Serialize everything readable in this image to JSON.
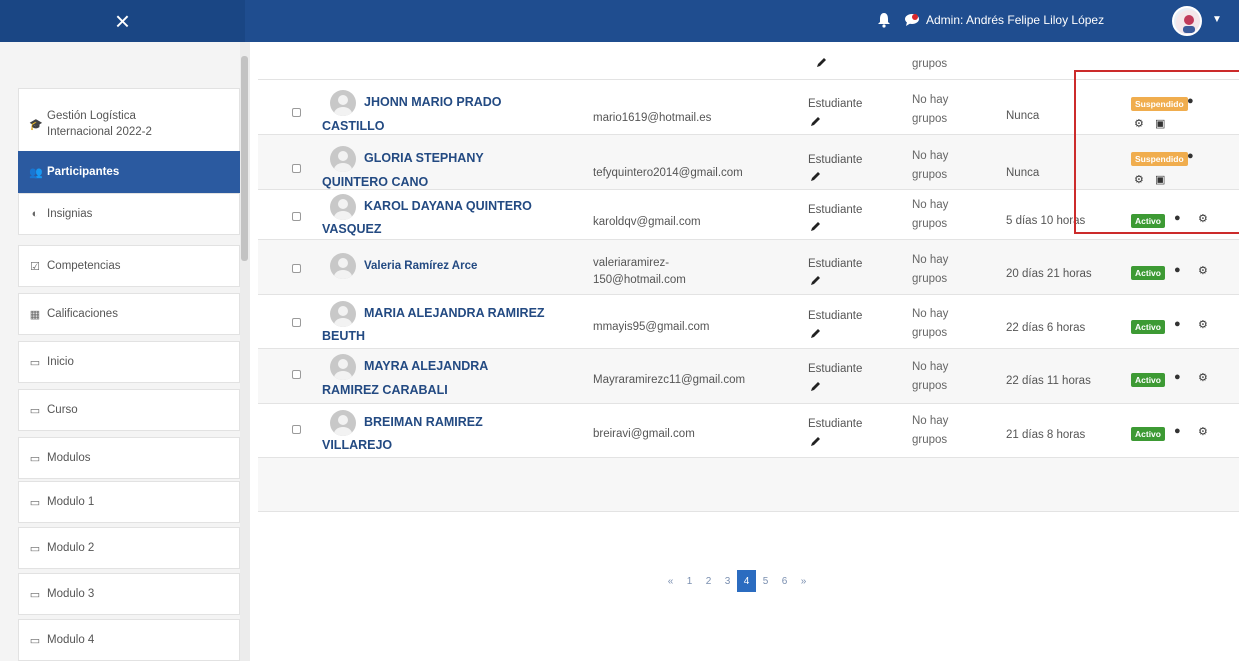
{
  "header": {
    "close_icon": "×",
    "admin_label": "Admin: Andrés Felipe Liloy López",
    "caret": "▼"
  },
  "sidebar": {
    "items": [
      {
        "label": "Gestión Logística Internacional 2022-2",
        "icon": "graduation-cap-icon",
        "glyph": "🎓"
      },
      {
        "label": "Participantes",
        "icon": "users-icon",
        "glyph": "👥",
        "active": true
      },
      {
        "label": "Insignias",
        "icon": "shield-icon",
        "glyph": "◐"
      },
      {
        "label": "Competencias",
        "icon": "checklist-icon",
        "glyph": "☑"
      },
      {
        "label": "Calificaciones",
        "icon": "table-icon",
        "glyph": "▦"
      },
      {
        "label": "Inicio",
        "icon": "folder-icon",
        "glyph": "▭"
      },
      {
        "label": "Curso",
        "icon": "folder-icon",
        "glyph": "▭"
      },
      {
        "label": "Modulos",
        "icon": "folder-icon",
        "glyph": "▭"
      },
      {
        "label": "Modulo 1",
        "icon": "folder-icon",
        "glyph": "▭"
      },
      {
        "label": "Modulo 2",
        "icon": "folder-icon",
        "glyph": "▭"
      },
      {
        "label": "Modulo 3",
        "icon": "folder-icon",
        "glyph": "▭"
      },
      {
        "label": "Modulo 4",
        "icon": "folder-icon",
        "glyph": "▭"
      }
    ]
  },
  "partial_row": {
    "groups": "grupos"
  },
  "participants": [
    {
      "name1": "JHONN MARIO PRADO",
      "name2": "CASTILLO",
      "email1": "mario1619@hotmail.es",
      "email2": "",
      "role": "Estudiante",
      "groups1": "No hay",
      "groups2": "grupos",
      "last_access": "Nunca",
      "status": "Suspendido"
    },
    {
      "name1": "GLORIA STEPHANY",
      "name2": "QUINTERO CANO",
      "email1": "tefyquintero2014@gmail.com",
      "email2": "",
      "role": "Estudiante",
      "groups1": "No hay",
      "groups2": "grupos",
      "last_access": "Nunca",
      "status": "Suspendido"
    },
    {
      "name1": "KAROL DAYANA QUINTERO",
      "name2": "VASQUEZ",
      "email1": "karoldqv@gmail.com",
      "email2": "",
      "role": "Estudiante",
      "groups1": "No hay",
      "groups2": "grupos",
      "last_access": "5 días 10 horas",
      "status": "Activo"
    },
    {
      "name1": "Valeria Ramírez Arce",
      "name2": "",
      "email1": "valeriaramirez-",
      "email2": "150@hotmail.com",
      "role": "Estudiante",
      "groups1": "No hay",
      "groups2": "grupos",
      "last_access": "20 días 21 horas",
      "status": "Activo"
    },
    {
      "name1": "MARIA ALEJANDRA RAMIREZ",
      "name2": "BEUTH",
      "email1": "mmayis95@gmail.com",
      "email2": "",
      "role": "Estudiante",
      "groups1": "No hay",
      "groups2": "grupos",
      "last_access": "22 días 6 horas",
      "status": "Activo"
    },
    {
      "name1": "MAYRA ALEJANDRA",
      "name2": "RAMIREZ CARABALI",
      "email1": "Mayraramirezc11@gmail.com",
      "email2": "",
      "role": "Estudiante",
      "groups1": "No hay",
      "groups2": "grupos",
      "last_access": "22 días 11 horas",
      "status": "Activo"
    },
    {
      "name1": "BREIMAN RAMIREZ",
      "name2": "VILLAREJO",
      "email1": "breiravi@gmail.com",
      "email2": "",
      "role": "Estudiante",
      "groups1": "No hay",
      "groups2": "grupos",
      "last_access": "21 días 8 horas",
      "status": "Activo"
    }
  ],
  "pagination": {
    "prev": "«",
    "pages": [
      "1",
      "2",
      "3",
      "4",
      "5",
      "6"
    ],
    "current": "4",
    "next": "»"
  },
  "colors": {
    "topbar": "#1f4d8f",
    "active_sidebar": "#2b5aa0",
    "suspended": "#f0ad4e",
    "active_badge": "#3d9a34",
    "highlight": "#cc2b2b"
  }
}
